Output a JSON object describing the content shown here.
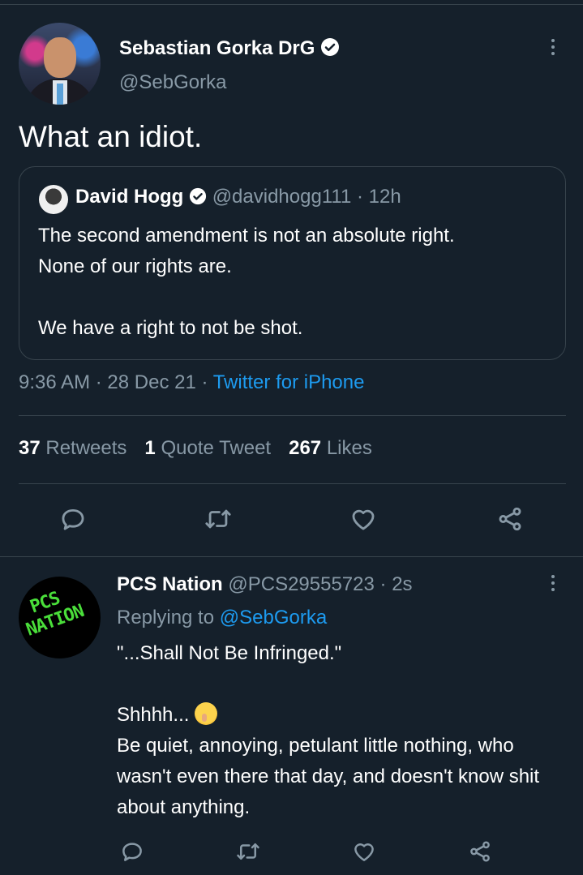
{
  "tweet": {
    "author_name": "Sebastian Gorka DrG",
    "author_handle": "@SebGorka",
    "text": "What an idiot.",
    "quoted": {
      "name": "David Hogg",
      "handle": "@davidhogg111",
      "time": "12h",
      "body": "The second amendment is not an absolute right.\nNone of our rights are.\n\nWe have a right to not be shot."
    },
    "time": "9:36 AM",
    "date": "28 Dec 21",
    "source": "Twitter for iPhone",
    "stats": {
      "retweets_count": "37",
      "retweets_label": "Retweets",
      "quotes_count": "1",
      "quotes_label": "Quote Tweet",
      "likes_count": "267",
      "likes_label": "Likes"
    },
    "actions": [
      "reply-icon",
      "retweet-icon",
      "like-icon",
      "share-icon"
    ]
  },
  "reply": {
    "name": "PCS Nation",
    "handle": "@PCS29555723",
    "time": "2s",
    "replying_prefix": "Replying to",
    "replying_to": "@SebGorka",
    "avatar_text_1": "PCS",
    "avatar_text_2": "NATION",
    "body_line1": "\"...Shall Not Be Infringed.\"",
    "body_shh": "Shhhh...",
    "body_rest": "Be quiet, annoying, petulant little nothing, who wasn't even there that day, and doesn't know shit about anything.",
    "actions": [
      "reply-icon",
      "retweet-icon",
      "like-icon",
      "share-icon"
    ]
  },
  "colors": {
    "background": "#15202b",
    "secondary_text": "#8899a6",
    "link": "#1d9bf0",
    "divider": "#38444d"
  }
}
